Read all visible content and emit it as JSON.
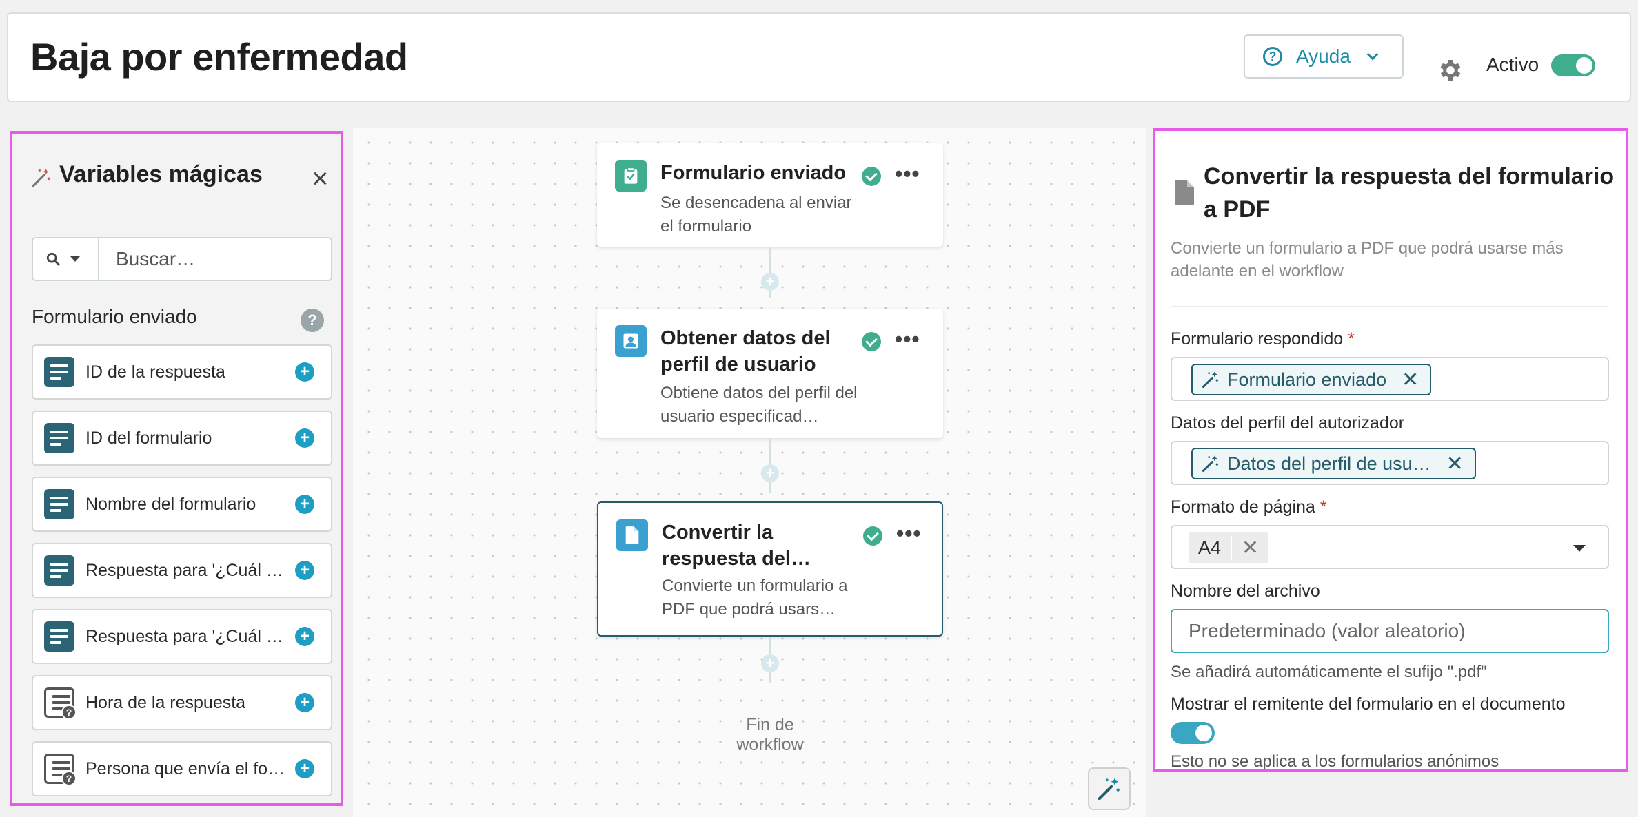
{
  "header": {
    "title": "Baja por enfermedad",
    "help_label": "Ayuda",
    "active_label": "Activo",
    "active": true
  },
  "left_panel": {
    "title": "Variables mágicas",
    "search_placeholder": "Buscar…",
    "section_title": "Formulario enviado",
    "items": [
      {
        "label": "ID de la respuesta",
        "icon": "field-icon"
      },
      {
        "label": "ID del formulario",
        "icon": "field-icon"
      },
      {
        "label": "Nombre del formulario",
        "icon": "field-icon"
      },
      {
        "label": "Respuesta para '¿Cuál e…",
        "icon": "field-icon"
      },
      {
        "label": "Respuesta para '¿Cuál e…",
        "icon": "field-icon"
      },
      {
        "label": "Hora de la respuesta",
        "icon": "field-unknown-icon"
      },
      {
        "label": "Persona que envía el for…",
        "icon": "field-unknown-icon"
      }
    ]
  },
  "workflow": {
    "nodes": [
      {
        "title": "Formulario enviado",
        "description": "Se desencadena al enviar el formulario",
        "status": "ok",
        "icon": "form-check-icon",
        "icon_color": "#40ae8c"
      },
      {
        "title": "Obtener datos del perfil de usuario",
        "description": "Obtiene datos del perfil del usuario especificad…",
        "status": "ok",
        "icon": "user-icon",
        "icon_color": "#3aa0d0"
      },
      {
        "title": "Convertir la respuesta del…",
        "description": "Convierte un formulario a PDF que podrá usars…",
        "status": "ok",
        "icon": "document-icon",
        "icon_color": "#3aa0d0",
        "selected": true
      }
    ],
    "end_label": "Fin de workflow"
  },
  "right_panel": {
    "title": "Convertir la respuesta del formulario a PDF",
    "description": "Convierte un formulario a PDF que podrá usarse más adelante en el workflow",
    "fields": {
      "form_label": "Formulario respondido",
      "form_value": "Formulario enviado",
      "profile_label": "Datos del perfil del autorizador",
      "profile_value": "Datos del perfil de usu…",
      "page_format_label": "Formato de página",
      "page_format_value": "A4",
      "filename_label": "Nombre del archivo",
      "filename_placeholder": "Predeterminado (valor aleatorio)",
      "filename_hint": "Se añadirá automáticamente el sufijo \".pdf\"",
      "show_sender_label": "Mostrar el remitente del formulario en el documento",
      "show_sender": true,
      "show_sender_hint": "Esto no se aplica a los formularios anónimos"
    },
    "required_mark": "*"
  },
  "colors": {
    "accent": "#1d8aa6",
    "success": "#40ae8c",
    "chip_border": "#265b6a",
    "highlight_border": "#e65ce6"
  }
}
